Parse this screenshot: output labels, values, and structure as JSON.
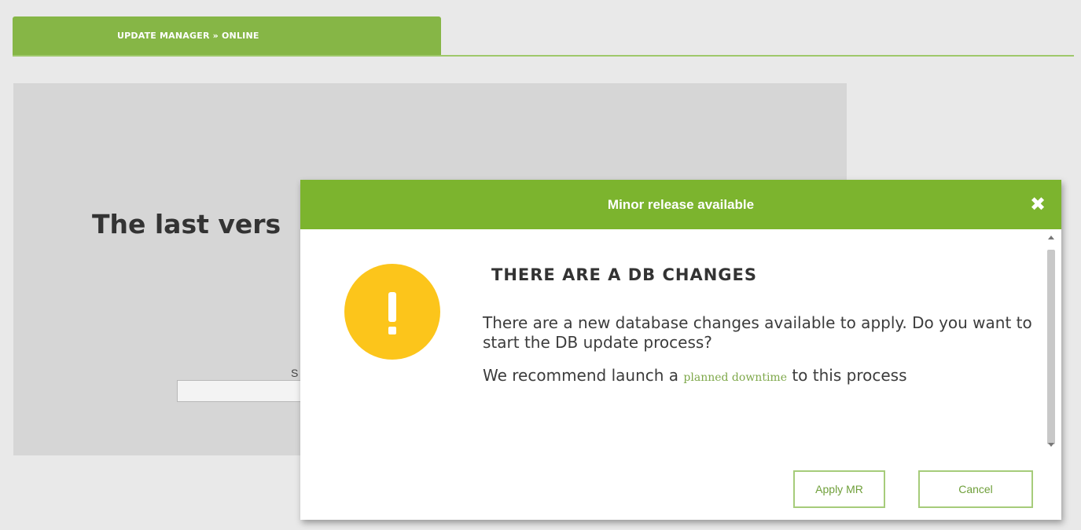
{
  "tab": {
    "label": "UPDATE MANAGER » ONLINE"
  },
  "background_panel": {
    "heading": "The last vers",
    "small_text": "S"
  },
  "modal": {
    "title": "Minor release available",
    "close_glyph": "✖",
    "icon": "warning-exclamation-icon",
    "message_title": "THERE ARE A DB CHANGES",
    "paragraph1": "There are a new database changes available to apply. Do you want to start the DB update process?",
    "paragraph2_prefix": "We recommend launch a",
    "paragraph2_link": "planned downtime",
    "paragraph2_suffix": "to this process",
    "buttons": {
      "apply": "Apply MR",
      "cancel": "Cancel"
    }
  },
  "colors": {
    "accent_green": "#7cb42e",
    "tab_green": "#86b646",
    "warning_yellow": "#fcc51b",
    "button_border": "#a6cc7a"
  }
}
